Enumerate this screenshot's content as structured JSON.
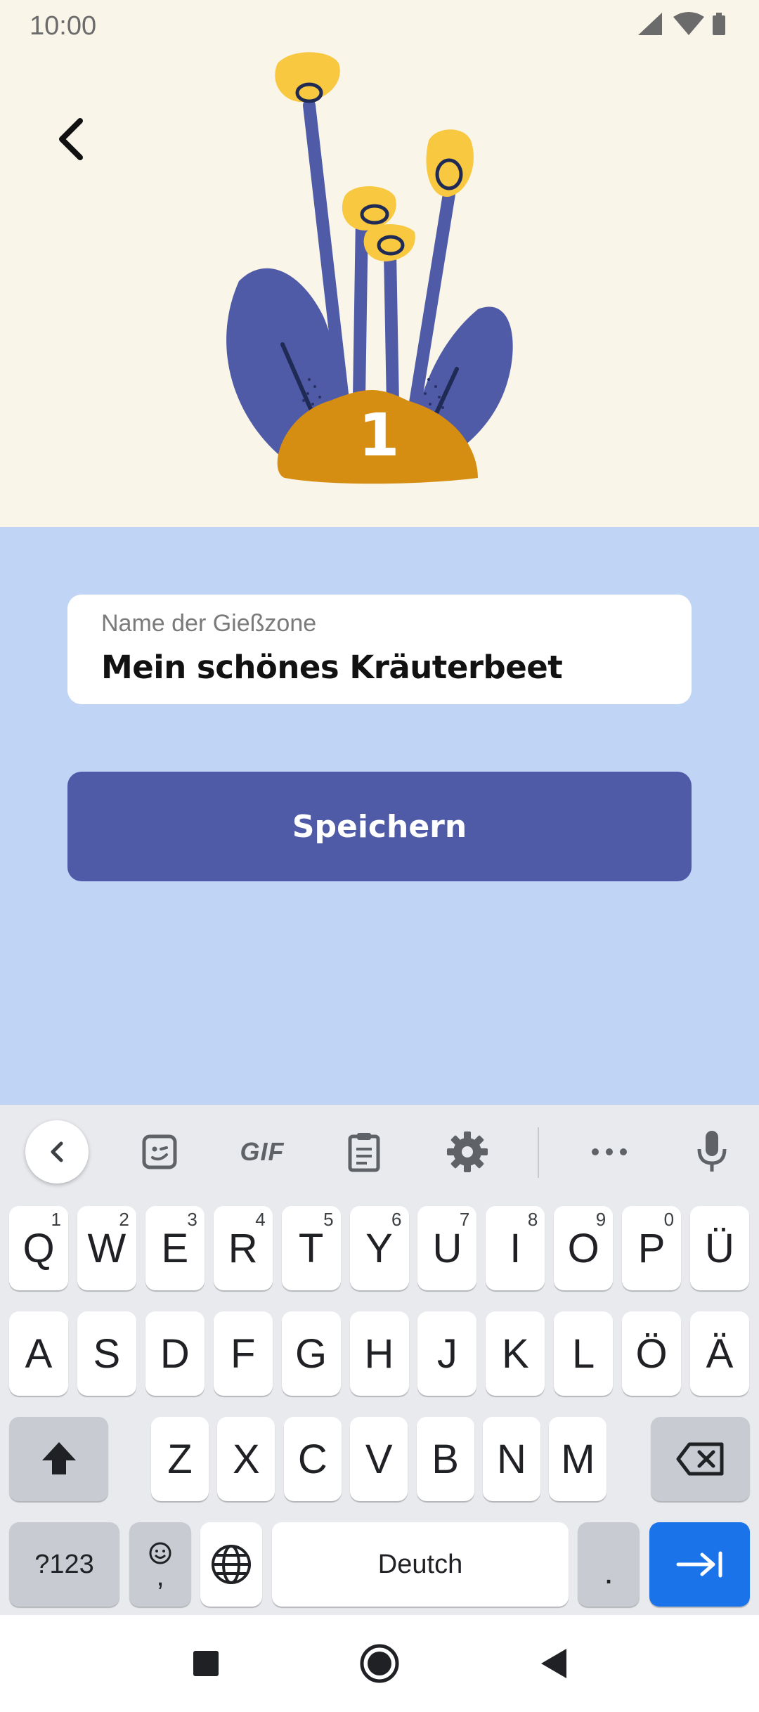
{
  "status_bar": {
    "time": "10:00",
    "icons": [
      "signal-icon",
      "wifi-icon",
      "battery-icon"
    ]
  },
  "header": {
    "back_icon": "chevron-left-icon",
    "illustration_number": "1"
  },
  "form": {
    "field_label": "Name der Gießzone",
    "field_value": "Mein schönes Kräuterbeet",
    "save_label": "Speichern"
  },
  "keyboard": {
    "toolbar": {
      "gif_label": "GIF",
      "icons": [
        "collapse-icon",
        "sticker-icon",
        "gif-icon",
        "clipboard-icon",
        "settings-icon",
        "more-icon",
        "microphone-icon"
      ]
    },
    "row1": [
      {
        "label": "Q",
        "hint": "1"
      },
      {
        "label": "W",
        "hint": "2"
      },
      {
        "label": "E",
        "hint": "3"
      },
      {
        "label": "R",
        "hint": "4"
      },
      {
        "label": "T",
        "hint": "5"
      },
      {
        "label": "Y",
        "hint": "6"
      },
      {
        "label": "U",
        "hint": "7"
      },
      {
        "label": "I",
        "hint": "8"
      },
      {
        "label": "O",
        "hint": "9"
      },
      {
        "label": "P",
        "hint": "0"
      },
      {
        "label": "Ü",
        "hint": ""
      }
    ],
    "row2": [
      "A",
      "S",
      "D",
      "F",
      "G",
      "H",
      "J",
      "K",
      "L",
      "Ö",
      "Ä"
    ],
    "row3": [
      "Z",
      "X",
      "C",
      "V",
      "B",
      "N",
      "M"
    ],
    "symbols_label": "?123",
    "emoji_comma_label": ",",
    "space_label": "Deutch",
    "period_label": "."
  },
  "colors": {
    "header_bg": "#faf5e9",
    "page_bg": "#c0d4f6",
    "button_bg": "#4f5ba7",
    "plant_blue": "#4f5ba7",
    "flower_yellow": "#f8c840",
    "pot_orange": "#d68e12",
    "enter_key": "#1a73e8"
  },
  "navigation_bar": {
    "icons": [
      "recents-icon",
      "home-icon",
      "back-icon"
    ]
  }
}
